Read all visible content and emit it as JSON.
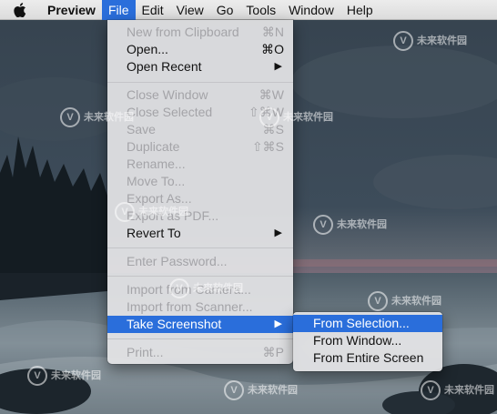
{
  "menubar": {
    "app_name": "Preview",
    "items": [
      "File",
      "Edit",
      "View",
      "Go",
      "Tools",
      "Window",
      "Help"
    ],
    "active": "File"
  },
  "file_menu": {
    "items": [
      {
        "label": "New from Clipboard",
        "shortcut": "⌘N",
        "enabled": false
      },
      {
        "label": "Open...",
        "shortcut": "⌘O",
        "enabled": true
      },
      {
        "label": "Open Recent",
        "submenu": true,
        "enabled": true
      },
      {
        "label": "Close Window",
        "shortcut": "⌘W",
        "enabled": false
      },
      {
        "label": "Close Selected",
        "shortcut": "⇧⌘W",
        "enabled": false
      },
      {
        "label": "Save",
        "shortcut": "⌘S",
        "enabled": false
      },
      {
        "label": "Duplicate",
        "shortcut": "⇧⌘S",
        "enabled": false
      },
      {
        "label": "Rename...",
        "enabled": false
      },
      {
        "label": "Move To...",
        "enabled": false
      },
      {
        "label": "Export As...",
        "enabled": false
      },
      {
        "label": "Export as PDF...",
        "enabled": false
      },
      {
        "label": "Revert To",
        "submenu": true,
        "enabled": true
      },
      {
        "label": "Enter Password...",
        "enabled": false
      },
      {
        "label": "Import from Camera...",
        "enabled": false
      },
      {
        "label": "Import from Scanner...",
        "enabled": false
      },
      {
        "label": "Take Screenshot",
        "submenu": true,
        "enabled": true,
        "highlighted": true
      },
      {
        "label": "Print...",
        "shortcut": "⌘P",
        "enabled": false
      }
    ],
    "submenu_arrow": "▶"
  },
  "screenshot_submenu": {
    "items": [
      {
        "label": "From Selection...",
        "highlighted": true
      },
      {
        "label": "From Window..."
      },
      {
        "label": "From Entire Screen"
      }
    ]
  },
  "watermark": {
    "text": "未来软件园",
    "url": "www.orsoon.com"
  },
  "colors": {
    "highlight": "#2a6edb",
    "menu_bg": "#e4e4e6",
    "disabled_text": "#a4a4a8"
  }
}
